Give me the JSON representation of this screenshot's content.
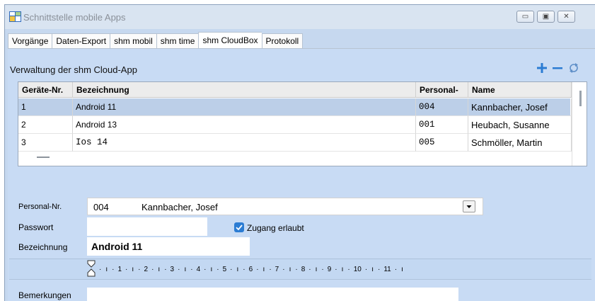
{
  "window": {
    "title": "Schnittstelle mobile Apps"
  },
  "tabs": [
    {
      "label": "Vorgänge"
    },
    {
      "label": "Daten-Export"
    },
    {
      "label": "shm mobil"
    },
    {
      "label": "shm time"
    },
    {
      "label": "shm CloudBox"
    },
    {
      "label": "Protokoll"
    }
  ],
  "cloud": {
    "section_title": "Verwaltung der shm Cloud-App",
    "columns": [
      "Geräte-Nr.",
      "Bezeichnung",
      "Personal-",
      "Name"
    ],
    "rows": [
      {
        "nr": "1",
        "bezeichnung": "Android 11",
        "personal": "004",
        "name": "Kannbacher, Josef",
        "selected": true
      },
      {
        "nr": "2",
        "bezeichnung": "Android 13",
        "personal": "001",
        "name": "Heubach, Susanne",
        "selected": false
      },
      {
        "nr": "3",
        "bezeichnung": "Ios 14",
        "personal": "005",
        "name": "Schmöller, Martin",
        "selected": false
      }
    ]
  },
  "form": {
    "personal_label": "Personal-Nr.",
    "personal_nr": "004",
    "personal_name": "Kannbacher, Josef",
    "passwort_label": "Passwort",
    "zugang_label": "Zugang erlaubt",
    "zugang_checked": true,
    "bezeichnung_label": "Bezeichnung",
    "bezeichnung_value": "Android 11",
    "bemerkungen_label": "Bemerkungen"
  },
  "ruler": {
    "numbers": [
      "1",
      "2",
      "3",
      "4",
      "5",
      "6",
      "7",
      "8",
      "9",
      "10",
      "11"
    ]
  },
  "colors": {
    "accent": "#2b7cd3",
    "selection": "#bccfe8",
    "panel": "#c8dbf4"
  },
  "icons": [
    "app-icon",
    "add-icon",
    "remove-icon",
    "refresh-icon",
    "dropdown-arrow-icon",
    "checkbox-checked-icon"
  ]
}
